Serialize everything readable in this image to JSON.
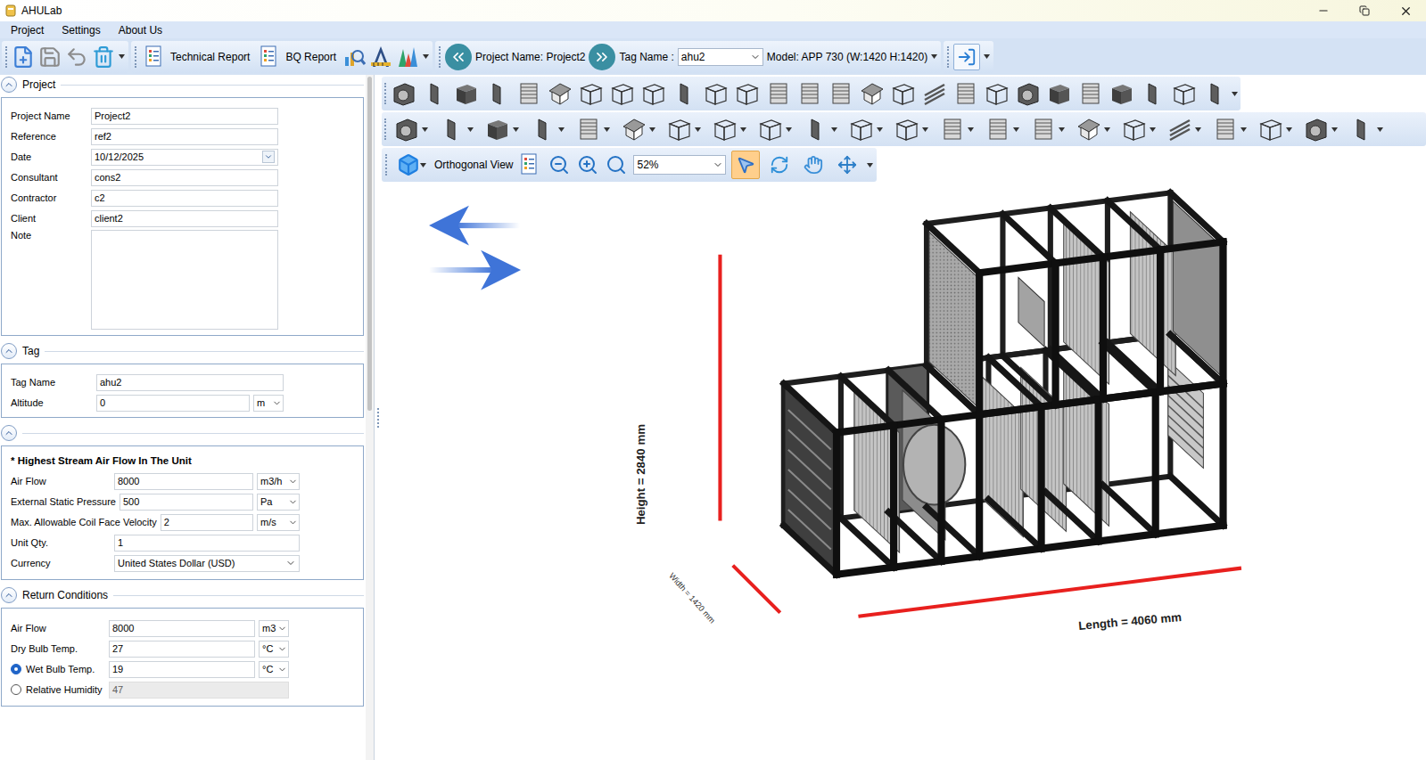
{
  "window": {
    "title": "AHULab"
  },
  "menu": [
    "Project",
    "Settings",
    "About Us"
  ],
  "toolbar": {
    "buttons": [
      {
        "label": "Technical Report"
      },
      {
        "label": "BQ Report"
      }
    ],
    "project_name": "Project Name: Project2",
    "tag_label": "Tag Name :",
    "tag_value": "ahu2",
    "model": "Model: APP 730 (W:1420 H:1420)"
  },
  "sections": [
    {
      "title": "Project",
      "expanded": true,
      "fields": [
        {
          "label": "Project Name",
          "value": "Project2",
          "kind": "text"
        },
        {
          "label": "Reference",
          "value": "ref2",
          "kind": "text"
        },
        {
          "label": "Date",
          "value": "10/12/2025",
          "kind": "date"
        },
        {
          "label": "Consultant",
          "value": "cons2",
          "kind": "text"
        },
        {
          "label": "Contractor",
          "value": "c2",
          "kind": "text"
        },
        {
          "label": "Client",
          "value": "client2",
          "kind": "text"
        },
        {
          "label": "Note",
          "value": "",
          "kind": "textarea"
        }
      ]
    },
    {
      "title": "Tag",
      "expanded": true,
      "fields": [
        {
          "label": "Tag Name",
          "value": "ahu2",
          "kind": "text"
        },
        {
          "label": "Altitude",
          "value": "0",
          "unit": "m",
          "kind": "unit"
        }
      ]
    },
    {
      "title": "",
      "expanded": true,
      "heading": "* Highest Stream Air Flow In The Unit",
      "fields": [
        {
          "label": "Air Flow",
          "value": "8000",
          "unit": "m3/h",
          "kind": "unit"
        },
        {
          "label": "External Static Pressure",
          "value": "500",
          "unit": "Pa",
          "kind": "unit"
        },
        {
          "label": "Max. Allowable Coil Face Velocity",
          "value": "2",
          "unit": "m/s",
          "kind": "unit"
        },
        {
          "label": "Unit Qty.",
          "value": "1",
          "kind": "text"
        },
        {
          "label": "Currency",
          "value": "United States Dollar (USD)",
          "kind": "select"
        }
      ]
    },
    {
      "title": "Return Conditions",
      "expanded": true,
      "fields": [
        {
          "label": "Air Flow",
          "value": "8000",
          "unit": "m3",
          "kind": "unit"
        },
        {
          "label": "Dry Bulb Temp.",
          "value": "27",
          "unit": "°C",
          "kind": "unit"
        },
        {
          "label": "Wet Bulb Temp.",
          "value": "19",
          "unit": "°C",
          "kind": "radio",
          "selected": true,
          "disabled": false
        },
        {
          "label": "Relative Humidity",
          "value": "47",
          "kind": "radio",
          "selected": false,
          "disabled": true
        }
      ]
    }
  ],
  "view_toolbar": {
    "view": "Orthogonal View",
    "zoom": "52%",
    "tools": [
      {
        "kind": "select",
        "selected": true
      },
      {
        "kind": "rotate",
        "selected": false
      },
      {
        "kind": "pan",
        "selected": false
      },
      {
        "kind": "move",
        "selected": false
      }
    ]
  },
  "canvas": {
    "height_label": "Height = 2840 mm",
    "width_label": "Width = 1420 mm",
    "length_label": "Length = 4060 mm"
  }
}
